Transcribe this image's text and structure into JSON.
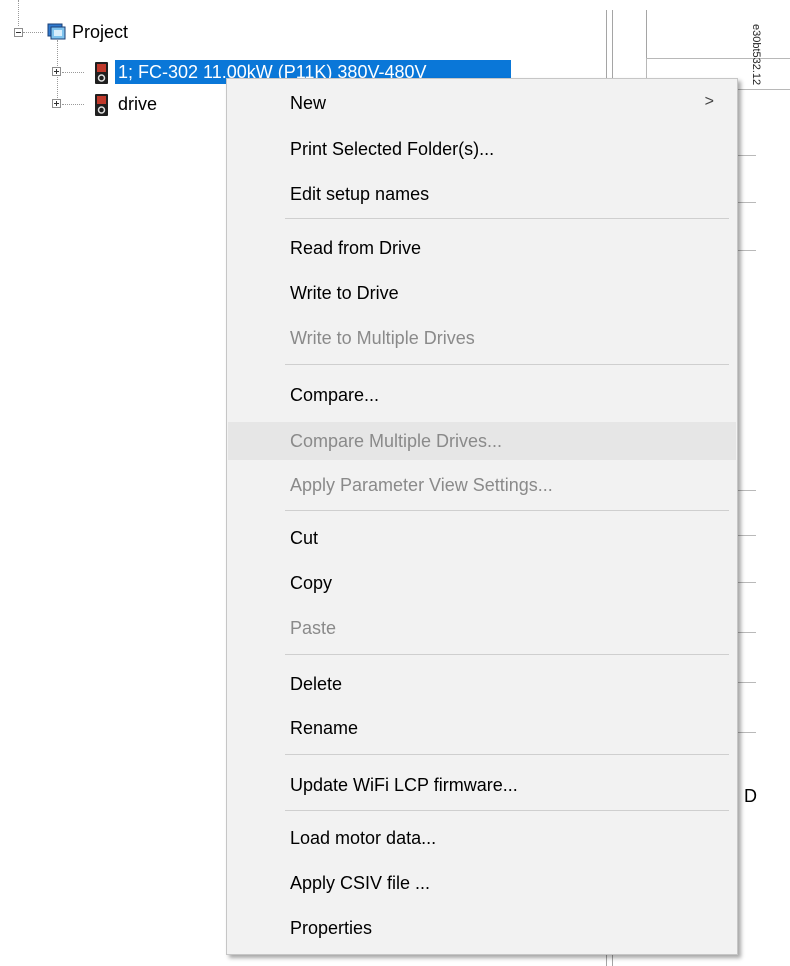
{
  "figure_id": "e30bt532.12",
  "tree": {
    "root_label": "Project",
    "items": [
      {
        "label": "1; FC-302 11.00kW (P11K) 380V-480V",
        "selected": true
      },
      {
        "label": "drive",
        "selected": false
      }
    ]
  },
  "background": {
    "partial_letter": "D"
  },
  "context_menu": {
    "items": [
      {
        "label": "New",
        "disabled": false,
        "has_submenu": true,
        "submenu_glyph": ">"
      },
      {
        "label": "Print Selected Folder(s)...",
        "disabled": false
      },
      {
        "label": "Edit setup names",
        "disabled": false
      },
      {
        "label": "Read from Drive",
        "disabled": false
      },
      {
        "label": "Write to Drive",
        "disabled": false
      },
      {
        "label": "Write to Multiple Drives",
        "disabled": true
      },
      {
        "label": "Compare...",
        "disabled": false
      },
      {
        "label": "Compare Multiple Drives...",
        "disabled": true,
        "highlighted": true
      },
      {
        "label": "Apply Parameter View Settings...",
        "disabled": true
      },
      {
        "label": "Cut",
        "disabled": false
      },
      {
        "label": "Copy",
        "disabled": false
      },
      {
        "label": "Paste",
        "disabled": true
      },
      {
        "label": "Delete",
        "disabled": false
      },
      {
        "label": "Rename",
        "disabled": false
      },
      {
        "label": "Update WiFi LCP firmware...",
        "disabled": false
      },
      {
        "label": "Load motor data...",
        "disabled": false
      },
      {
        "label": "Apply CSIV file ...",
        "disabled": false
      },
      {
        "label": "Properties",
        "disabled": false
      }
    ]
  },
  "colors": {
    "selection": "#0a77d8",
    "menu_background": "#f2f2f2",
    "disabled_text": "#8a8a8a",
    "hover_row": "#e6e6e6"
  }
}
